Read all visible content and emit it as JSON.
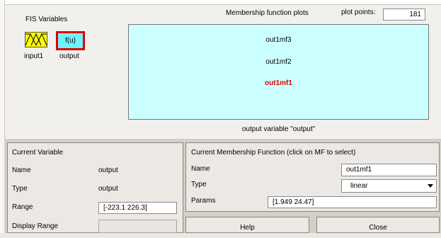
{
  "fis": {
    "title": "FIS Variables",
    "input_label": "input1",
    "output_label": "output",
    "output_box_text": "f(u)"
  },
  "mf_plot": {
    "title": "Membership function plots",
    "plot_points_label": "plot points:",
    "plot_points_value": "181",
    "mfs": [
      {
        "name": "out1mf3",
        "selected": false
      },
      {
        "name": "out1mf2",
        "selected": false
      },
      {
        "name": "out1mf1",
        "selected": true
      }
    ],
    "caption": "output variable \"output\""
  },
  "current_variable": {
    "title": "Current Variable",
    "name_label": "Name",
    "name_value": "output",
    "type_label": "Type",
    "type_value": "output",
    "range_label": "Range",
    "range_value": "[-223.1 226.3]",
    "display_range_label": "Display Range",
    "display_range_value": ""
  },
  "current_mf": {
    "title": "Current Membership Function (click on MF to select)",
    "name_label": "Name",
    "name_value": "out1mf1",
    "type_label": "Type",
    "type_value": "linear",
    "params_label": "Params",
    "params_value": "[1.949 24.47]"
  },
  "buttons": {
    "help": "Help",
    "close": "Close"
  },
  "colors": {
    "plot_bg": "#ccffff",
    "input_icon_bg": "#ffff00",
    "output_icon_bg": "#6ef3ff",
    "selected_outline": "#e00000",
    "selected_mf_text": "#e00000"
  },
  "icons": {
    "input_icon": "triangular-membership-icon",
    "dropdown_icon": "chevron-down-icon"
  }
}
